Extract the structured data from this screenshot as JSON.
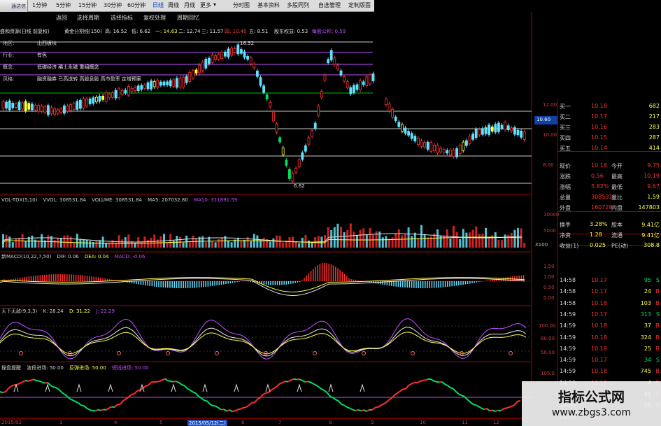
{
  "menubar": {
    "app_name": "通达信",
    "tabs": [
      "1分钟",
      "5分钟",
      "15分钟",
      "30分钟",
      "60分钟",
      "日线",
      "周线",
      "月线",
      "更多"
    ],
    "right_items": [
      "分时图",
      "基本资料",
      "多股同列",
      "自选管理",
      "定制版面"
    ]
  },
  "toolbar": {
    "items": [
      "返回",
      "选择周期",
      "选择指标",
      "复权处理",
      "周期回忆"
    ]
  },
  "infobar": {
    "stock": "盛和资源(日线 前复权)",
    "indicator": "黄金分割线(150)",
    "high_label": "高: 16.52",
    "low_label": "低: 6.62",
    "a1": "一: 14.63",
    "a2": "二: 12.74",
    "a3": "三: 11.57",
    "a4": "四: 10.40",
    "a5": "五: 8.51",
    "extra1": "股东权益: 0.53",
    "extra2": "每股公积: 0.59"
  },
  "info_panel": [
    {
      "label": "地区:",
      "value": "山西板块"
    },
    {
      "label": "行业:",
      "value": "有色"
    },
    {
      "label": "概念:",
      "value": "低碳经济 稀土永磁 重组概念"
    },
    {
      "label": "风格:",
      "value": "融资融券 已高送转 高股息股 高市盈率 定增预案"
    }
  ],
  "price_axis": [
    "12.00",
    "10.60",
    "10.00",
    "8.00"
  ],
  "price_marks": {
    "hi": "16.52",
    "lo": "6.62"
  },
  "vol_header": {
    "name": "VOL-TDX(5,10)",
    "vvol": "VVOL: 308531.84",
    "volume": "VOLUME: 308531.84",
    "ma5": "MA5: 207032.80",
    "ma10": "MA10: 311891.59"
  },
  "vol_axis": [
    "10000",
    "5000",
    "X100"
  ],
  "macd_header": {
    "name": "新MACD(10,22,7,50)",
    "dif": "DIF: 0.06",
    "dea": "DEA: 0.04",
    "macd": "MACD: -0.06"
  },
  "macd_axis": [
    "1.50",
    "1.00",
    "0.50",
    "0.00"
  ],
  "kdj_header": {
    "name": "天下无敌(9,3,3)",
    "k": "K: 28.24",
    "d": "D: 31.22",
    "j": "J: 22.29"
  },
  "kdj_axis": [
    "100.00",
    "80.00",
    "50.00"
  ],
  "last_header": {
    "name": "操盘提醒",
    "a": "波段进场: 50.00",
    "b": "反弹进场: 50.00",
    "c": "短线进场: 50.00"
  },
  "last_axis": [
    "105.0"
  ],
  "quote": {
    "bids": [
      {
        "label": "买一",
        "price": "10.18",
        "vol": "682"
      },
      {
        "label": "买二",
        "price": "10.17",
        "vol": "217"
      },
      {
        "label": "买三",
        "price": "10.16",
        "vol": "283"
      },
      {
        "label": "买四",
        "price": "10.15",
        "vol": "287"
      },
      {
        "label": "买五",
        "price": "10.14",
        "vol": "414"
      }
    ],
    "stats": [
      {
        "l1": "现价",
        "v1": "10.18",
        "l2": "今开",
        "v2": "9.75"
      },
      {
        "l1": "涨跌",
        "v1": "0.56",
        "l2": "最高",
        "v2": "10.19"
      },
      {
        "l1": "涨幅",
        "v1": "5.82%",
        "l2": "最低",
        "v2": "9.67"
      },
      {
        "l1": "总量",
        "v1": "308531",
        "l2": "量比",
        "v2": "1.59"
      },
      {
        "l1": "外盘",
        "v1": "160728",
        "l2": "内盘",
        "v2": "147803"
      }
    ],
    "stats2": [
      {
        "l1": "换手",
        "v1": "3.28%",
        "l2": "股本",
        "v2": "9.41亿"
      },
      {
        "l1": "净资",
        "v1": "1.28",
        "l2": "流通",
        "v2": "9.41亿"
      },
      {
        "l1": "收益(1)",
        "v1": "0.025",
        "l2": "PE(动)",
        "v2": "308.8"
      }
    ],
    "ticks": [
      {
        "t": "14:58",
        "p": "10.17",
        "v": "95",
        "s": "S"
      },
      {
        "t": "14:58",
        "p": "10.17",
        "v": "24",
        "s": "B"
      },
      {
        "t": "14:58",
        "p": "10.18",
        "v": "103",
        "s": "B"
      },
      {
        "t": "14:59",
        "p": "10.17",
        "v": "313",
        "s": "S"
      },
      {
        "t": "14:59",
        "p": "10.18",
        "v": "37",
        "s": "B"
      },
      {
        "t": "14:59",
        "p": "10.18",
        "v": "324",
        "s": "B"
      },
      {
        "t": "14:59",
        "p": "10.18",
        "v": "25",
        "s": "B"
      },
      {
        "t": "14:59",
        "p": "10.17",
        "v": "34",
        "s": "S"
      },
      {
        "t": "14:59",
        "p": "10.18",
        "v": "745",
        "s": "B"
      },
      {
        "t": "14:59",
        "p": "10.18",
        "v": "4",
        "s": "B"
      },
      {
        "t": "14:59",
        "p": "10.18",
        "v": "81",
        "s": "B"
      },
      {
        "t": "14:59",
        "p": "10.18",
        "v": "15",
        "s": "B"
      },
      {
        "t": "14:59",
        "p": "10.18",
        "v": "",
        "s": ""
      }
    ]
  },
  "time_axis": [
    "2015/02",
    "3",
    "4",
    "5",
    "2015/05/12(二)",
    "6",
    "7",
    "8",
    "9",
    "10",
    "11",
    "12"
  ],
  "watermark": {
    "title": "指标公式网",
    "url": "www.zbgs3.com"
  },
  "colors": {
    "up": "#ff3030",
    "down": "#00e060",
    "purple": "#c050ff",
    "yellow": "#ffff40",
    "cyan": "#60e0ff",
    "grid": "#a00000"
  }
}
